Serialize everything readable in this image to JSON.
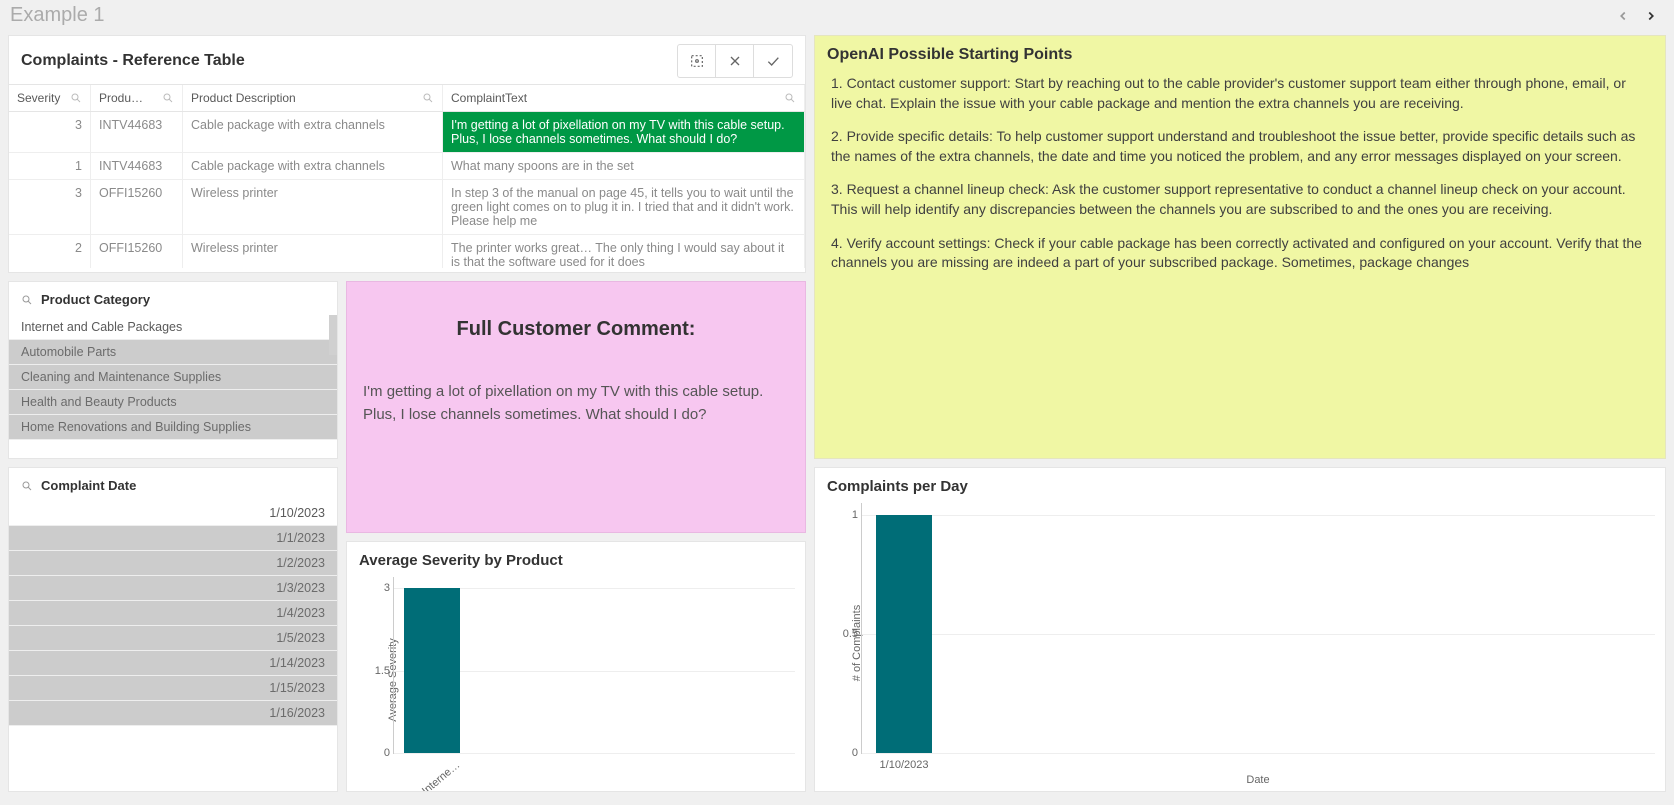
{
  "sheet": {
    "title": "Example 1"
  },
  "complaints_table": {
    "title": "Complaints - Reference Table",
    "columns": {
      "severity": "Severity",
      "product": "Produ…",
      "description": "Product Description",
      "text": "ComplaintText"
    },
    "rows": [
      {
        "severity": "3",
        "product": "INTV44683",
        "description": "Cable package with extra channels",
        "text": "I'm getting a lot of pixellation on my TV with this cable setup. Plus, I lose channels sometimes. What should I do?",
        "selected": true
      },
      {
        "severity": "1",
        "product": "INTV44683",
        "description": "Cable package with extra channels",
        "text": "What many spoons are in the set",
        "selected": false
      },
      {
        "severity": "3",
        "product": "OFFI15260",
        "description": "Wireless printer",
        "text": "In step 3 of the manual on page 45, it tells you to wait until the green light comes on to plug it in. I tried that and it didn't work. Please help me",
        "selected": false
      },
      {
        "severity": "2",
        "product": "OFFI15260",
        "description": "Wireless printer",
        "text": "The printer works great… The only thing I would say about it is that the software used for it does",
        "selected": false
      }
    ]
  },
  "openai": {
    "title": "OpenAI Possible Starting Points",
    "paragraphs": [
      "1. Contact customer support: Start by reaching out to the cable provider's customer support team either through phone, email, or live chat. Explain the issue with your cable package and mention the extra channels you are receiving.",
      "2. Provide specific details: To help customer support understand and troubleshoot the issue better, provide specific details such as the names of the extra channels, the date and time you noticed the problem, and any error messages displayed on your screen.",
      "3. Request a channel lineup check: Ask the customer support representative to conduct a channel lineup check on your account. This will help identify any discrepancies between the channels you are subscribed to and the ones you are receiving.",
      "4. Verify account settings: Check if your cable package has been correctly activated and configured on your account. Verify that the channels you are missing are indeed a part of your subscribed package. Sometimes, package changes"
    ]
  },
  "product_category": {
    "title": "Product Category",
    "items": [
      {
        "label": "Internet and Cable Packages",
        "state": "possible"
      },
      {
        "label": "Automobile Parts",
        "state": "excluded"
      },
      {
        "label": "Cleaning and Maintenance Supplies",
        "state": "excluded"
      },
      {
        "label": "Health and Beauty Products",
        "state": "excluded"
      },
      {
        "label": "Home Renovations and Building Supplies",
        "state": "excluded"
      }
    ]
  },
  "complaint_date": {
    "title": "Complaint Date",
    "items": [
      {
        "label": "1/10/2023",
        "state": "possible"
      },
      {
        "label": "1/1/2023",
        "state": "excluded"
      },
      {
        "label": "1/2/2023",
        "state": "excluded"
      },
      {
        "label": "1/3/2023",
        "state": "excluded"
      },
      {
        "label": "1/4/2023",
        "state": "excluded"
      },
      {
        "label": "1/5/2023",
        "state": "excluded"
      },
      {
        "label": "1/14/2023",
        "state": "excluded"
      },
      {
        "label": "1/15/2023",
        "state": "excluded"
      },
      {
        "label": "1/16/2023",
        "state": "excluded"
      }
    ]
  },
  "comment": {
    "title": "Full Customer Comment:",
    "body": "I'm getting a lot of pixellation on my TV with this cable setup. Plus, I lose channels sometimes. What should I do?"
  },
  "avg_severity": {
    "title": "Average Severity by Product"
  },
  "complaints_per_day": {
    "title": "Complaints per Day"
  },
  "chart_data": [
    {
      "id": "avg_severity",
      "type": "bar",
      "title": "Average Severity by Product",
      "ylabel": "Average Severity",
      "xlabel": "",
      "categories": [
        "Interne…"
      ],
      "values": [
        3
      ],
      "yticks": [
        0,
        1.5,
        3
      ],
      "ylim": [
        0,
        3.2
      ]
    },
    {
      "id": "complaints_per_day",
      "type": "bar",
      "title": "Complaints per Day",
      "ylabel": "# of Complaints",
      "xlabel": "Date",
      "categories": [
        "1/10/2023"
      ],
      "values": [
        1
      ],
      "yticks": [
        0,
        0.5,
        1
      ],
      "ylim": [
        0,
        1.05
      ]
    }
  ]
}
